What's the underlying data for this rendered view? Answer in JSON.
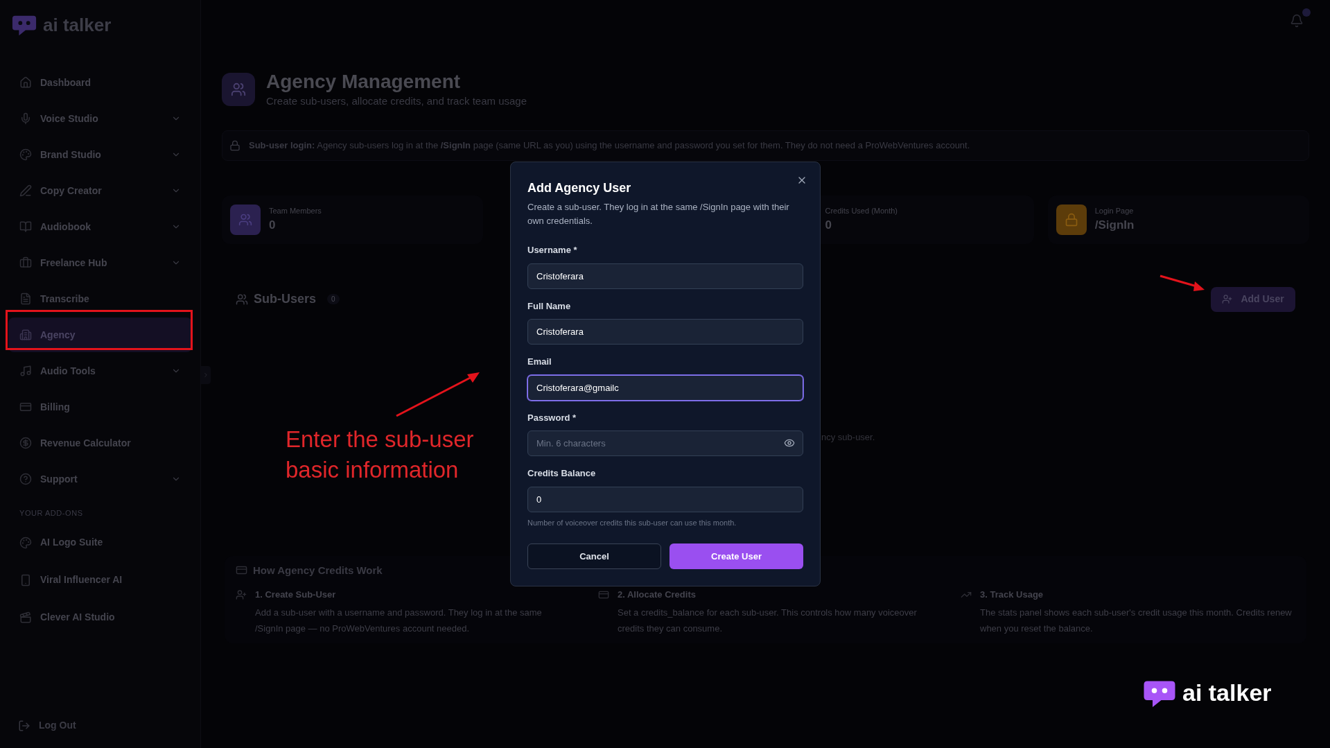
{
  "brand": {
    "logo_text": "ai talker"
  },
  "sidebar": {
    "items": [
      {
        "label": "Dashboard",
        "expandable": false,
        "selected": false
      },
      {
        "label": "Voice Studio",
        "expandable": true,
        "selected": false
      },
      {
        "label": "Brand Studio",
        "expandable": true,
        "selected": false
      },
      {
        "label": "Copy Creator",
        "expandable": true,
        "selected": false
      },
      {
        "label": "Audiobook",
        "expandable": true,
        "selected": false
      },
      {
        "label": "Freelance Hub",
        "expandable": true,
        "selected": false
      },
      {
        "label": "Transcribe",
        "expandable": false,
        "selected": false
      },
      {
        "label": "Agency",
        "expandable": false,
        "selected": true
      },
      {
        "label": "Audio Tools",
        "expandable": true,
        "selected": false
      },
      {
        "label": "Billing",
        "expandable": false,
        "selected": false
      },
      {
        "label": "Revenue Calculator",
        "expandable": false,
        "selected": false
      },
      {
        "label": "Support",
        "expandable": true,
        "selected": false
      }
    ],
    "section_label": "YOUR ADD-ONS",
    "addons": [
      {
        "label": "AI Logo Suite"
      },
      {
        "label": "Viral Influencer AI"
      },
      {
        "label": "Clever AI Studio"
      }
    ],
    "logout": "Log Out"
  },
  "header": {
    "title": "Agency Management",
    "subtitle": "Create sub-users, allocate credits, and track team usage"
  },
  "notice": "**Sub-user login:** Agency sub-users log in at the **/SignIn** page (same URL as you) using the username and password you set for them. They do not need a ProWebVentures account.",
  "stats": [
    {
      "label": "Team Members",
      "value": "0",
      "color": "#2b2150"
    },
    {
      "label": "Credits Used (Month)",
      "value": "0"
    },
    {
      "label": "Login Page",
      "value": "/SignIn",
      "color": "#5c3c0a"
    }
  ],
  "sub_users": {
    "title": "Sub-Users",
    "count": "0",
    "add_button": "Add User",
    "empty_text": "ncy sub-user."
  },
  "how_it_works": {
    "title": "How Agency Credits Work",
    "steps": [
      {
        "title": "1. Create Sub-User",
        "text": "Add a sub-user with a username and password. They log in at the same /SignIn page — no ProWebVentures account needed."
      },
      {
        "title": "2. Allocate Credits",
        "text": "Set a credits_balance for each sub-user. This controls how many voiceover credits they can consume."
      },
      {
        "title": "3. Track Usage",
        "text": "The stats panel shows each sub-user's credit usage this month. Credits renew when you reset the balance."
      }
    ]
  },
  "dialog": {
    "title": "Add Agency User",
    "description": "Create a sub-user. They log in at the same /SignIn page with their own credentials.",
    "fields": [
      {
        "label": "Username *",
        "kind": "text",
        "value": "Cristoferara",
        "focused": false
      },
      {
        "label": "Full Name",
        "kind": "text",
        "value": "Cristoferara",
        "focused": false
      },
      {
        "label": "Email",
        "kind": "text",
        "value": "Cristoferara@gmailc",
        "focused": true
      },
      {
        "label": "Password *",
        "kind": "password",
        "placeholder": "Min. 6 characters",
        "focused": false
      },
      {
        "label": "Credits Balance",
        "kind": "text",
        "value": "0",
        "focused": false,
        "hint": "Number of voiceover credits this sub-user can use this month."
      }
    ],
    "cancel": "Cancel",
    "submit": "Create User"
  },
  "annotation": {
    "text": "Enter the sub-user basic information"
  },
  "corner_logo": {
    "text": "ai talker"
  }
}
